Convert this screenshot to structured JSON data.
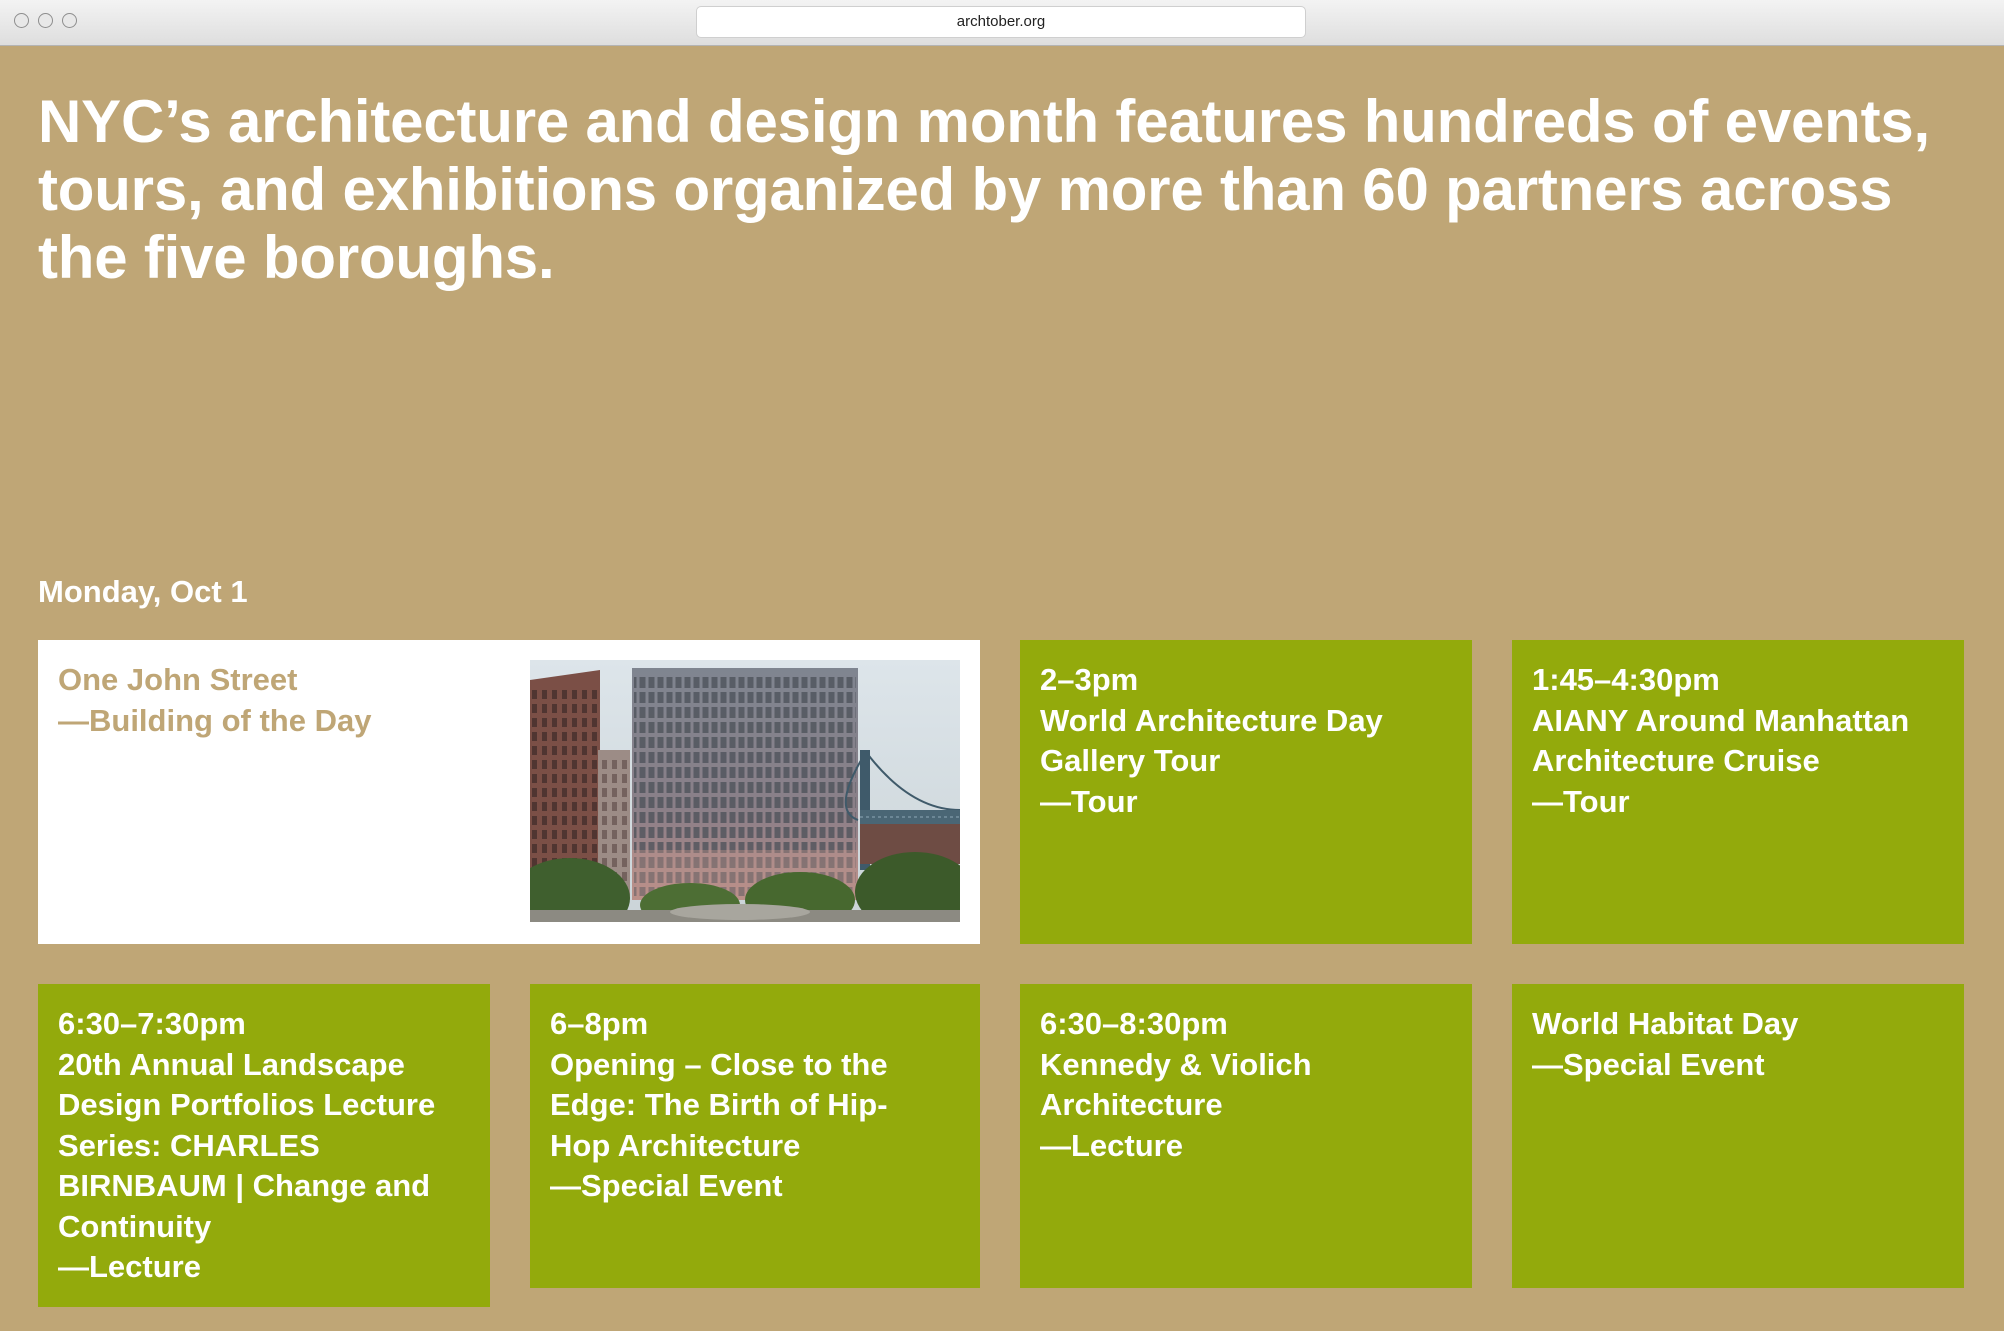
{
  "browser": {
    "url": "archtober.org"
  },
  "hero": {
    "text": "NYC’s architecture and design month features hundreds of events, tours, and exhibitions organized by more than 60 partners across the five boroughs."
  },
  "day": {
    "label": "Monday, Oct 1"
  },
  "featured": {
    "title": "One John Street",
    "category": "—Building of the Day",
    "image_icon": "building-photo"
  },
  "events": [
    {
      "time": "2–3pm",
      "title_lines": [
        "World Architecture Day",
        "Gallery Tour"
      ],
      "category": "—Tour"
    },
    {
      "time": "1:45–4:30pm",
      "title_lines": [
        "AIANY Around Manhattan",
        "Architecture Cruise"
      ],
      "category": "—Tour"
    },
    {
      "time": "6:30–7:30pm",
      "title_lines": [
        "20th Annual Landscape",
        "Design Portfolios Lecture",
        "Series: CHARLES",
        "BIRNBAUM | Change and",
        "Continuity"
      ],
      "category": "—Lecture"
    },
    {
      "time": "6–8pm",
      "title_lines": [
        "Opening – Close to the",
        "Edge: The Birth of Hip-",
        "Hop Architecture"
      ],
      "category": "—Special Event"
    },
    {
      "time": "6:30–8:30pm",
      "title_lines": [
        "Kennedy & Violich",
        "Architecture"
      ],
      "category": "—Lecture"
    },
    {
      "title_lines": [
        "World Habitat Day"
      ],
      "category": "—Special Event"
    }
  ],
  "colors": {
    "background": "#bfa676",
    "card_green": "#93aa0c",
    "card_text": "#ffffff"
  }
}
